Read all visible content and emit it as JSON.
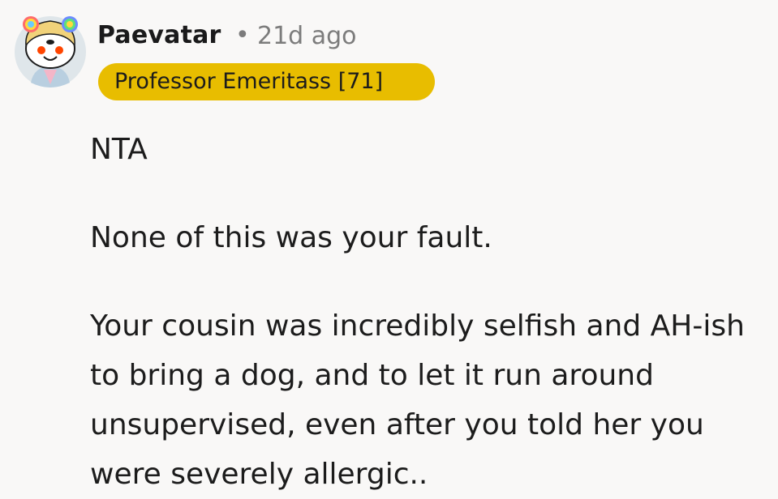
{
  "comment": {
    "author": "Paevatar",
    "separator": "•",
    "timestamp": "21d ago",
    "flair": "Professor Emeritass [71]",
    "paragraphs": [
      "NTA",
      "None of this was your fault.",
      "Your cousin was incredibly selfish and AH-ish to bring a dog, and to let it run around unsupervised, even after you told her you were severely allergic.."
    ]
  },
  "colors": {
    "background": "#f9f8f7",
    "flair_background": "#e8bd00",
    "meta_text": "#7c7c7c",
    "body_text": "#1c1c1c"
  },
  "avatar": {
    "icon": "snoo-avatar-icon"
  }
}
